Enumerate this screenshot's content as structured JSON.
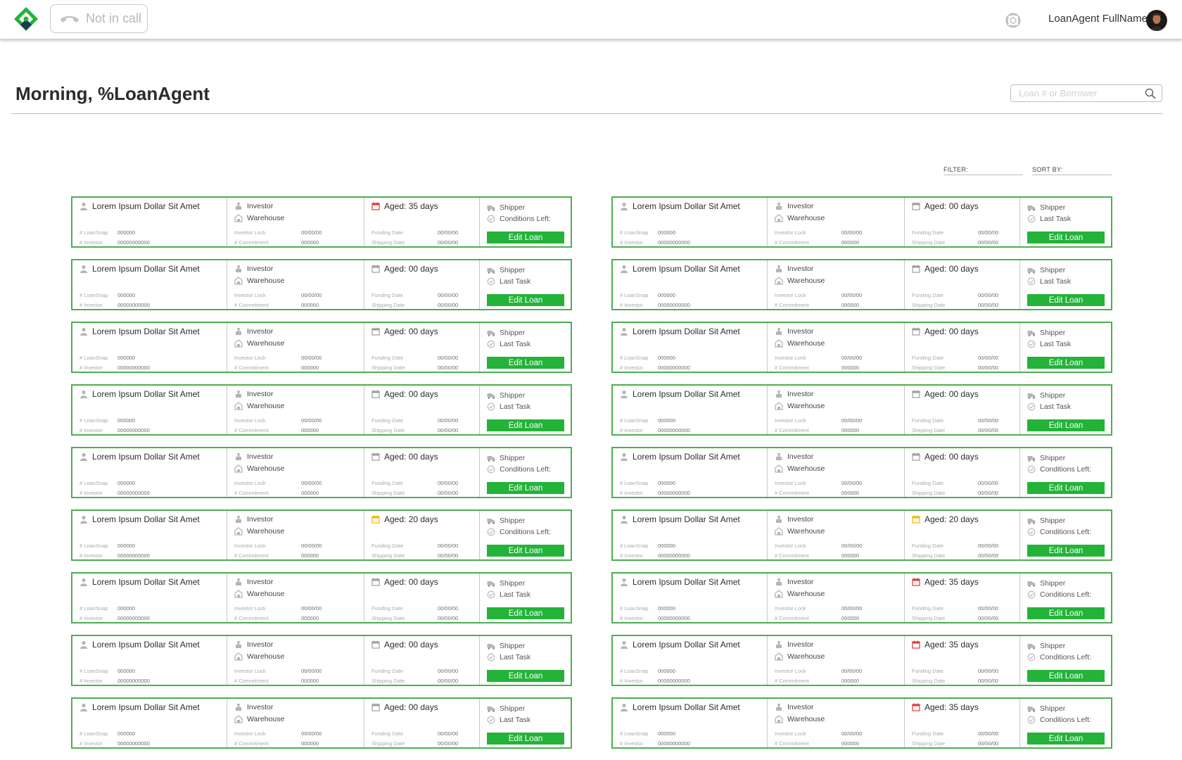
{
  "header": {
    "call_status": "Not in call",
    "user_name": "LoanAgent FullName"
  },
  "page": {
    "greeting": "Morning, %LoanAgent",
    "search_placeholder": "Loan # or Borrower",
    "filter_label": "FILTER:",
    "sort_label": "SORT BY:"
  },
  "colors": {
    "brand_green": "#23b339",
    "card_border": "#4caf50",
    "aged_red": "#e53935",
    "aged_yellow": "#f5b400",
    "aged_gray": "#9e9e9e"
  },
  "labels": {
    "loansnap": "# LoanSnap",
    "investor_num": "# Investor",
    "investor_lock": "Investor Lock",
    "commitment": "# Commitment",
    "funding_date": "Funding Date",
    "shipping_date": "Shipping Date",
    "investor": "Investor",
    "warehouse": "Warehouse",
    "shipper": "Shipper",
    "edit_loan": "Edit Loan"
  },
  "loans": [
    {
      "borrower": "Lorem Ipsum Dollar Sit Amet",
      "loansnap": "000000",
      "investor_num": "00000000000",
      "investor_lock": "00/00/00",
      "commitment": "000000",
      "funding_date": "00/00/00",
      "shipping_date": "00/00/00",
      "aged": "Aged: 35 days",
      "aged_status": "red",
      "task": "Conditions Left:"
    },
    {
      "borrower": "Lorem Ipsum Dollar Sit Amet",
      "loansnap": "000000",
      "investor_num": "00000000000",
      "investor_lock": "00/00/00",
      "commitment": "000000",
      "funding_date": "00/00/00",
      "shipping_date": "00/00/00",
      "aged": "Aged: 00 days",
      "aged_status": "gray",
      "task": "Last Task"
    },
    {
      "borrower": "Lorem Ipsum Dollar Sit Amet",
      "loansnap": "000000",
      "investor_num": "00000000000",
      "investor_lock": "00/00/00",
      "commitment": "000000",
      "funding_date": "00/00/00",
      "shipping_date": "00/00/00",
      "aged": "Aged: 00 days",
      "aged_status": "gray",
      "task": "Last Task"
    },
    {
      "borrower": "Lorem Ipsum Dollar Sit Amet",
      "loansnap": "000000",
      "investor_num": "00000000000",
      "investor_lock": "00/00/00",
      "commitment": "000000",
      "funding_date": "00/00/00",
      "shipping_date": "00/00/00",
      "aged": "Aged: 00 days",
      "aged_status": "gray",
      "task": "Last Task"
    },
    {
      "borrower": "Lorem Ipsum Dollar Sit Amet",
      "loansnap": "000000",
      "investor_num": "00000000000",
      "investor_lock": "00/00/00",
      "commitment": "000000",
      "funding_date": "00/00/00",
      "shipping_date": "00/00/00",
      "aged": "Aged: 00 days",
      "aged_status": "gray",
      "task": "Last Task"
    },
    {
      "borrower": "Lorem Ipsum Dollar Sit Amet",
      "loansnap": "000000",
      "investor_num": "00000000000",
      "investor_lock": "00/00/00",
      "commitment": "000000",
      "funding_date": "00/00/00",
      "shipping_date": "00/00/00",
      "aged": "Aged: 00 days",
      "aged_status": "gray",
      "task": "Last Task"
    },
    {
      "borrower": "Lorem Ipsum Dollar Sit Amet",
      "loansnap": "000000",
      "investor_num": "00000000000",
      "investor_lock": "00/00/00",
      "commitment": "000000",
      "funding_date": "00/00/00",
      "shipping_date": "00/00/00",
      "aged": "Aged: 00 days",
      "aged_status": "gray",
      "task": "Last Task"
    },
    {
      "borrower": "Lorem Ipsum Dollar Sit Amet",
      "loansnap": "000000",
      "investor_num": "00000000000",
      "investor_lock": "00/00/00",
      "commitment": "000000",
      "funding_date": "00/00/00",
      "shipping_date": "00/00/00",
      "aged": "Aged: 00 days",
      "aged_status": "gray",
      "task": "Last Task"
    },
    {
      "borrower": "Lorem Ipsum Dollar Sit Amet",
      "loansnap": "000000",
      "investor_num": "00000000000",
      "investor_lock": "00/00/00",
      "commitment": "000000",
      "funding_date": "00/00/00",
      "shipping_date": "00/00/00",
      "aged": "Aged: 00 days",
      "aged_status": "gray",
      "task": "Conditions Left:"
    },
    {
      "borrower": "Lorem Ipsum Dollar Sit Amet",
      "loansnap": "000000",
      "investor_num": "00000000000",
      "investor_lock": "00/00/00",
      "commitment": "000000",
      "funding_date": "00/00/00",
      "shipping_date": "00/00/00",
      "aged": "Aged: 00 days",
      "aged_status": "gray",
      "task": "Conditions Left:"
    },
    {
      "borrower": "Lorem Ipsum Dollar Sit Amet",
      "loansnap": "000000",
      "investor_num": "00000000000",
      "investor_lock": "00/00/00",
      "commitment": "000000",
      "funding_date": "00/00/00",
      "shipping_date": "00/00/00",
      "aged": "Aged: 20 days",
      "aged_status": "yellow",
      "task": "Conditions Left:"
    },
    {
      "borrower": "Lorem Ipsum Dollar Sit Amet",
      "loansnap": "000000",
      "investor_num": "00000000000",
      "investor_lock": "00/00/00",
      "commitment": "000000",
      "funding_date": "00/00/00",
      "shipping_date": "00/00/00",
      "aged": "Aged: 20 days",
      "aged_status": "yellow",
      "task": "Conditions Left:"
    },
    {
      "borrower": "Lorem Ipsum Dollar Sit Amet",
      "loansnap": "000000",
      "investor_num": "00000000000",
      "investor_lock": "00/00/00",
      "commitment": "000000",
      "funding_date": "00/00/00",
      "shipping_date": "00/00/00",
      "aged": "Aged: 00 days",
      "aged_status": "gray",
      "task": "Last Task"
    },
    {
      "borrower": "Lorem Ipsum Dollar Sit Amet",
      "loansnap": "000000",
      "investor_num": "00000000000",
      "investor_lock": "00/00/00",
      "commitment": "000000",
      "funding_date": "00/00/00",
      "shipping_date": "00/00/00",
      "aged": "Aged: 35 days",
      "aged_status": "red",
      "task": "Conditions Left:"
    },
    {
      "borrower": "Lorem Ipsum Dollar Sit Amet",
      "loansnap": "000000",
      "investor_num": "00000000000",
      "investor_lock": "00/00/00",
      "commitment": "000000",
      "funding_date": "00/00/00",
      "shipping_date": "00/00/00",
      "aged": "Aged: 00 days",
      "aged_status": "gray",
      "task": "Last Task"
    },
    {
      "borrower": "Lorem Ipsum Dollar Sit Amet",
      "loansnap": "000000",
      "investor_num": "00000000000",
      "investor_lock": "00/00/00",
      "commitment": "000000",
      "funding_date": "00/00/00",
      "shipping_date": "00/00/00",
      "aged": "Aged: 35 days",
      "aged_status": "red",
      "task": "Conditions Left:"
    },
    {
      "borrower": "Lorem Ipsum Dollar Sit Amet",
      "loansnap": "000000",
      "investor_num": "00000000000",
      "investor_lock": "00/00/00",
      "commitment": "000000",
      "funding_date": "00/00/00",
      "shipping_date": "00/00/00",
      "aged": "Aged: 00 days",
      "aged_status": "gray",
      "task": "Last Task"
    },
    {
      "borrower": "Lorem Ipsum Dollar Sit Amet",
      "loansnap": "000000",
      "investor_num": "00000000000",
      "investor_lock": "00/00/00",
      "commitment": "000000",
      "funding_date": "00/00/00",
      "shipping_date": "00/00/00",
      "aged": "Aged: 35 days",
      "aged_status": "red",
      "task": "Conditions Left:"
    }
  ]
}
